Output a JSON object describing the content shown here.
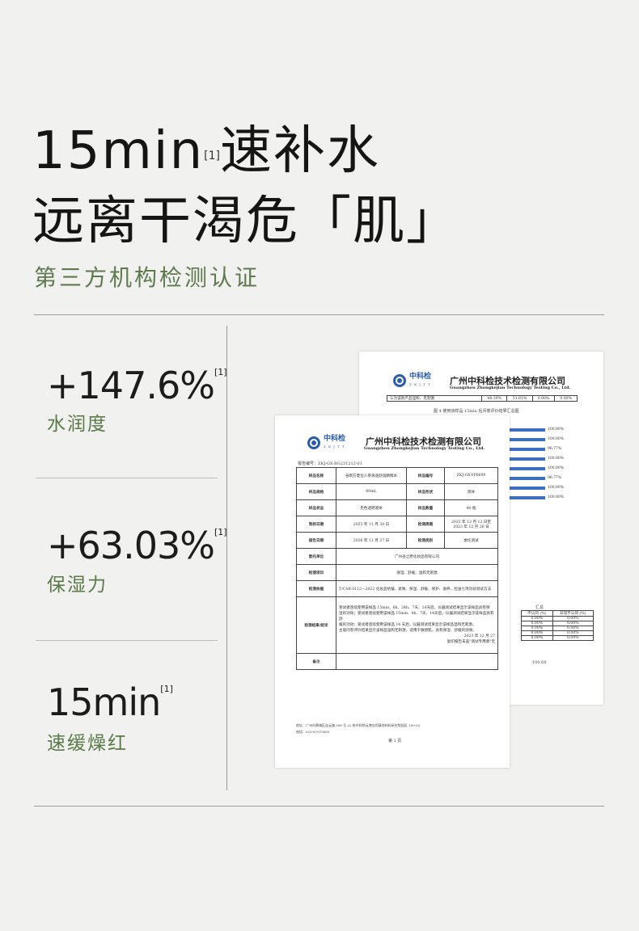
{
  "headline": {
    "line1_main": "15min",
    "line1_ref": "[1]",
    "line1_tail": "速补水",
    "line2": "远离干渴危「肌」"
  },
  "subtitle": "第三方机构检测认证",
  "stats": [
    {
      "value": "+147.6%",
      "ref": "[1]",
      "label": "水润度"
    },
    {
      "value": "+63.03%",
      "ref": "[1]",
      "label": "保湿力"
    },
    {
      "value": "15min",
      "ref": "[1]",
      "label": "速缓燥红"
    }
  ],
  "back_doc": {
    "logo": "中科检",
    "logo_sub": "Z K J T T",
    "company_cn": "广州中科检技术检测有限公司",
    "company_en": "Guangzhou Zhongkejian Technology Testing Co., Ltd.",
    "row_label": "认为该款产品温和、无刺激",
    "row_values": [
      "48.39%",
      "51.61%",
      "0.00%",
      "0.00%"
    ],
    "chart_title": "图 4  使用该样品 15min 后问卷评价结果汇总图",
    "bar_values": [
      "100.00%",
      "100.00%",
      "96.77%",
      "100.00%",
      "100.00%",
      "96.77%",
      "100.00%",
      "100.00%"
    ],
    "side_header": "汇总",
    "side_cols": [
      "不认同 (%)",
      "非常不认同 (%)"
    ],
    "side_rows": [
      [
        "0.00%",
        "0.00%"
      ],
      [
        "0.00%",
        "0.00%"
      ],
      [
        "0.00%",
        "0.00%"
      ],
      [
        "0.00%",
        "0.00%"
      ],
      [
        "0.00%",
        "0.00%"
      ]
    ],
    "side_footer": "100.68"
  },
  "front_doc": {
    "logo": "中科检",
    "logo_sub": "Z K J T T",
    "company_cn": "广州中科检技术检测有限公司",
    "company_en": "Guangzhou Zhongkejian Technology Testing Co., Ltd.",
    "report_no": "报告编号：ZKJ-GX-BG231212-01",
    "rows": [
      [
        "样品名称",
        "谷雨方夏位人参清透舒润精粹水",
        "样品编号",
        "ZKJ-GX-YP6699"
      ],
      [
        "样品规格",
        "60mL",
        "样品性状",
        "液体"
      ],
      [
        "样品状态",
        "无色透明液体",
        "样品数量",
        "40 瓶"
      ],
      [
        "到样日期",
        "2023 年 11 月 30 日",
        "检测周期",
        "2023 年 12 月 12 日至 2023 年 12 月 26 日"
      ],
      [
        "报告日期",
        "2026 年 11 月 27 日",
        "检测类别",
        "委托测试"
      ],
      [
        "委托单位",
        "广州谷之原化妆品有限公司",
        "",
        ""
      ],
      [
        "检测项目",
        "保湿、舒缓、温和无刺激",
        "",
        ""
      ],
      [
        "检测依据",
        "T/CAB 0112—2022 化妆品抗皱、紧致、保湿、舒缓、修护、滋养、控油七项功效测试方法",
        "",
        ""
      ]
    ],
    "conclusion_label": "检测结果/结论",
    "conclusion_lines": [
      "受试者连续使用该样品 15min、6h、24h、7天、14天后，仪器测试结果显示该样品具有保",
      "湿的功效；受试者连续使用该样品 15min、4h、7天、14天后，仪器测试结果显示该样品具有舒",
      "缓的功效；受试者连续使用该样品 14 天后，仪器测试结果显示该样品温和无刺激。",
      "主观问卷评价结果显示该样品温和无刺激，适用于敏感肌，具有保湿、舒缓的效果。"
    ],
    "sign_date": "2023 年 12 月 27",
    "sign_note": "复印报告未盖\"测试专用章\"无",
    "remark_label": "备注",
    "address": "地址：广州市黄埔区连云路 388 号 22 栋中科院云港应用基地材料研究院园区   100-03",
    "phone": "电话：020-87973669",
    "page": "第 1 页"
  }
}
